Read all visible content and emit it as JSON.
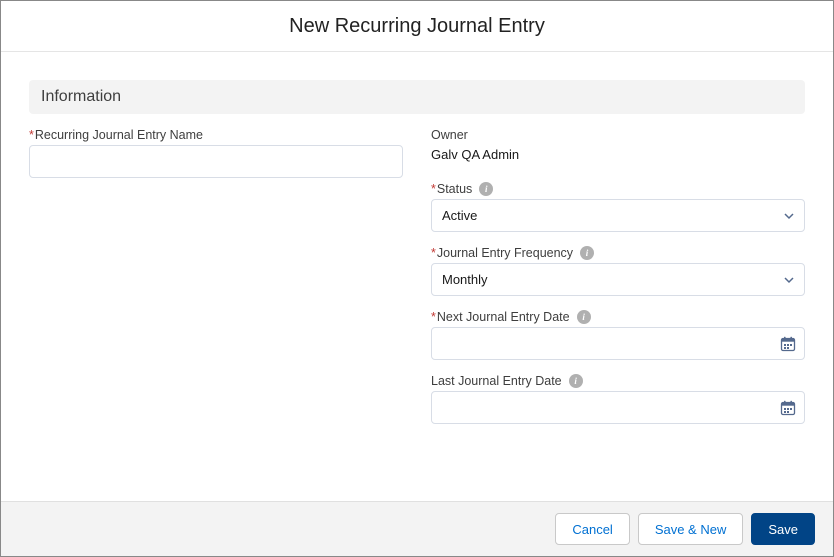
{
  "modal": {
    "title": "New Recurring Journal Entry"
  },
  "section": {
    "heading": "Information"
  },
  "fields": {
    "name": {
      "label": "Recurring Journal Entry Name",
      "value": ""
    },
    "owner": {
      "label": "Owner",
      "value": "Galv QA Admin"
    },
    "status": {
      "label": "Status",
      "value": "Active"
    },
    "frequency": {
      "label": "Journal Entry Frequency",
      "value": "Monthly"
    },
    "next_date": {
      "label": "Next Journal Entry Date",
      "value": ""
    },
    "last_date": {
      "label": "Last Journal Entry Date",
      "value": ""
    }
  },
  "footer": {
    "cancel": "Cancel",
    "save_new": "Save & New",
    "save": "Save"
  }
}
